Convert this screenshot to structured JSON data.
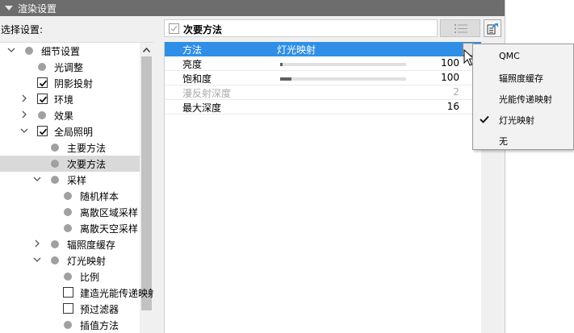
{
  "panel": {
    "title": "渲染设置",
    "select_label": "选择设置:"
  },
  "tree": {
    "items": [
      {
        "label": "细节设置",
        "indent": 0,
        "expander": "expanded",
        "marker": "dot",
        "selected": false
      },
      {
        "label": "光调整",
        "indent": 1,
        "expander": "none",
        "marker": "dot",
        "selected": false
      },
      {
        "label": "阴影投射",
        "indent": 1,
        "expander": "none",
        "marker": "checkbox-checked",
        "selected": false
      },
      {
        "label": "环境",
        "indent": 1,
        "expander": "collapsed",
        "marker": "checkbox-checked",
        "selected": false
      },
      {
        "label": "效果",
        "indent": 1,
        "expander": "collapsed",
        "marker": "dot",
        "selected": false
      },
      {
        "label": "全局照明",
        "indent": 1,
        "expander": "expanded",
        "marker": "checkbox-checked",
        "selected": false
      },
      {
        "label": "主要方法",
        "indent": 2,
        "expander": "none",
        "marker": "dot",
        "selected": false
      },
      {
        "label": "次要方法",
        "indent": 2,
        "expander": "none",
        "marker": "dot",
        "selected": true
      },
      {
        "label": "采样",
        "indent": 2,
        "expander": "expanded",
        "marker": "dot",
        "selected": false
      },
      {
        "label": "随机样本",
        "indent": 3,
        "expander": "none",
        "marker": "dot",
        "selected": false
      },
      {
        "label": "离散区域采样",
        "indent": 3,
        "expander": "none",
        "marker": "dot",
        "selected": false
      },
      {
        "label": "离散天空采样",
        "indent": 3,
        "expander": "none",
        "marker": "dot",
        "selected": false
      },
      {
        "label": "辐照度缓存",
        "indent": 2,
        "expander": "collapsed",
        "marker": "dot",
        "selected": false
      },
      {
        "label": "灯光映射",
        "indent": 2,
        "expander": "expanded",
        "marker": "dot",
        "selected": false
      },
      {
        "label": "比例",
        "indent": 3,
        "expander": "none",
        "marker": "dot",
        "selected": false
      },
      {
        "label": "建造光能传递映射",
        "indent": 3,
        "expander": "none",
        "marker": "checkbox-unchecked",
        "selected": false
      },
      {
        "label": "预过滤器",
        "indent": 3,
        "expander": "none",
        "marker": "checkbox-unchecked",
        "selected": false
      },
      {
        "label": "插值方法",
        "indent": 3,
        "expander": "none",
        "marker": "dot",
        "selected": false
      }
    ]
  },
  "header": {
    "title": "次要方法",
    "list_icon": "list-icon",
    "export_icon": "export-icon"
  },
  "properties": {
    "method": {
      "name": "方法",
      "value": "灯光映射"
    },
    "brightness": {
      "name": "亮度",
      "value": "100",
      "slider_level": 0.02
    },
    "saturation": {
      "name": "饱和度",
      "value": "100",
      "slider_level": 0.09
    },
    "reflection_depth": {
      "name": "漫反射深度",
      "value": "2"
    },
    "max_depth": {
      "name": "最大深度",
      "value": "16"
    }
  },
  "dropdown": {
    "options": [
      {
        "label": "QMC",
        "checked": false
      },
      {
        "label": "辐照度缓存",
        "checked": false
      },
      {
        "label": "光能传递映射",
        "checked": false
      },
      {
        "label": "灯光映射",
        "checked": true
      },
      {
        "label": "无",
        "checked": false
      }
    ]
  },
  "colors": {
    "accent": "#2f8fe6",
    "titlebar": "#6d6d6d",
    "selected_row": "#d9d9d9"
  }
}
